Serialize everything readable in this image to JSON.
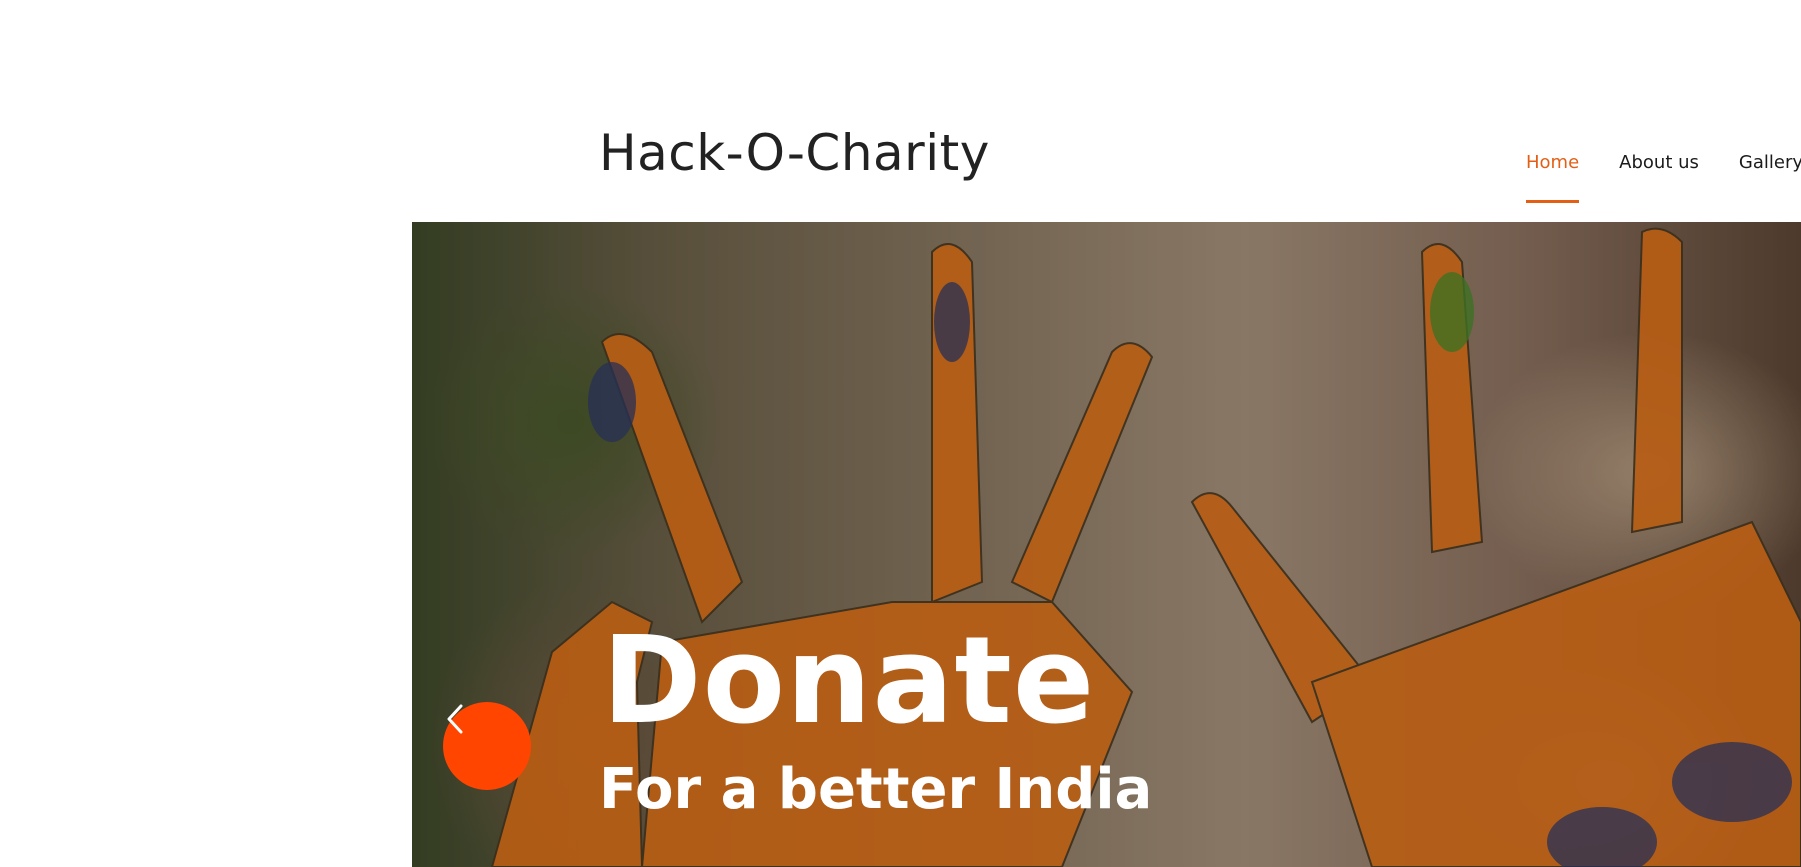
{
  "header": {
    "brand": "Hack-O-Charity",
    "nav": [
      {
        "label": "Home",
        "active": true
      },
      {
        "label": "About us",
        "active": false
      },
      {
        "label": "Gallery",
        "active": false
      }
    ]
  },
  "hero": {
    "title": "Donate",
    "subtitle": "For a better India",
    "prev_icon": "chevron-left-icon"
  },
  "colors": {
    "accent": "#e35f16",
    "carousel_button": "#ff4500",
    "text_dark": "#222222"
  }
}
